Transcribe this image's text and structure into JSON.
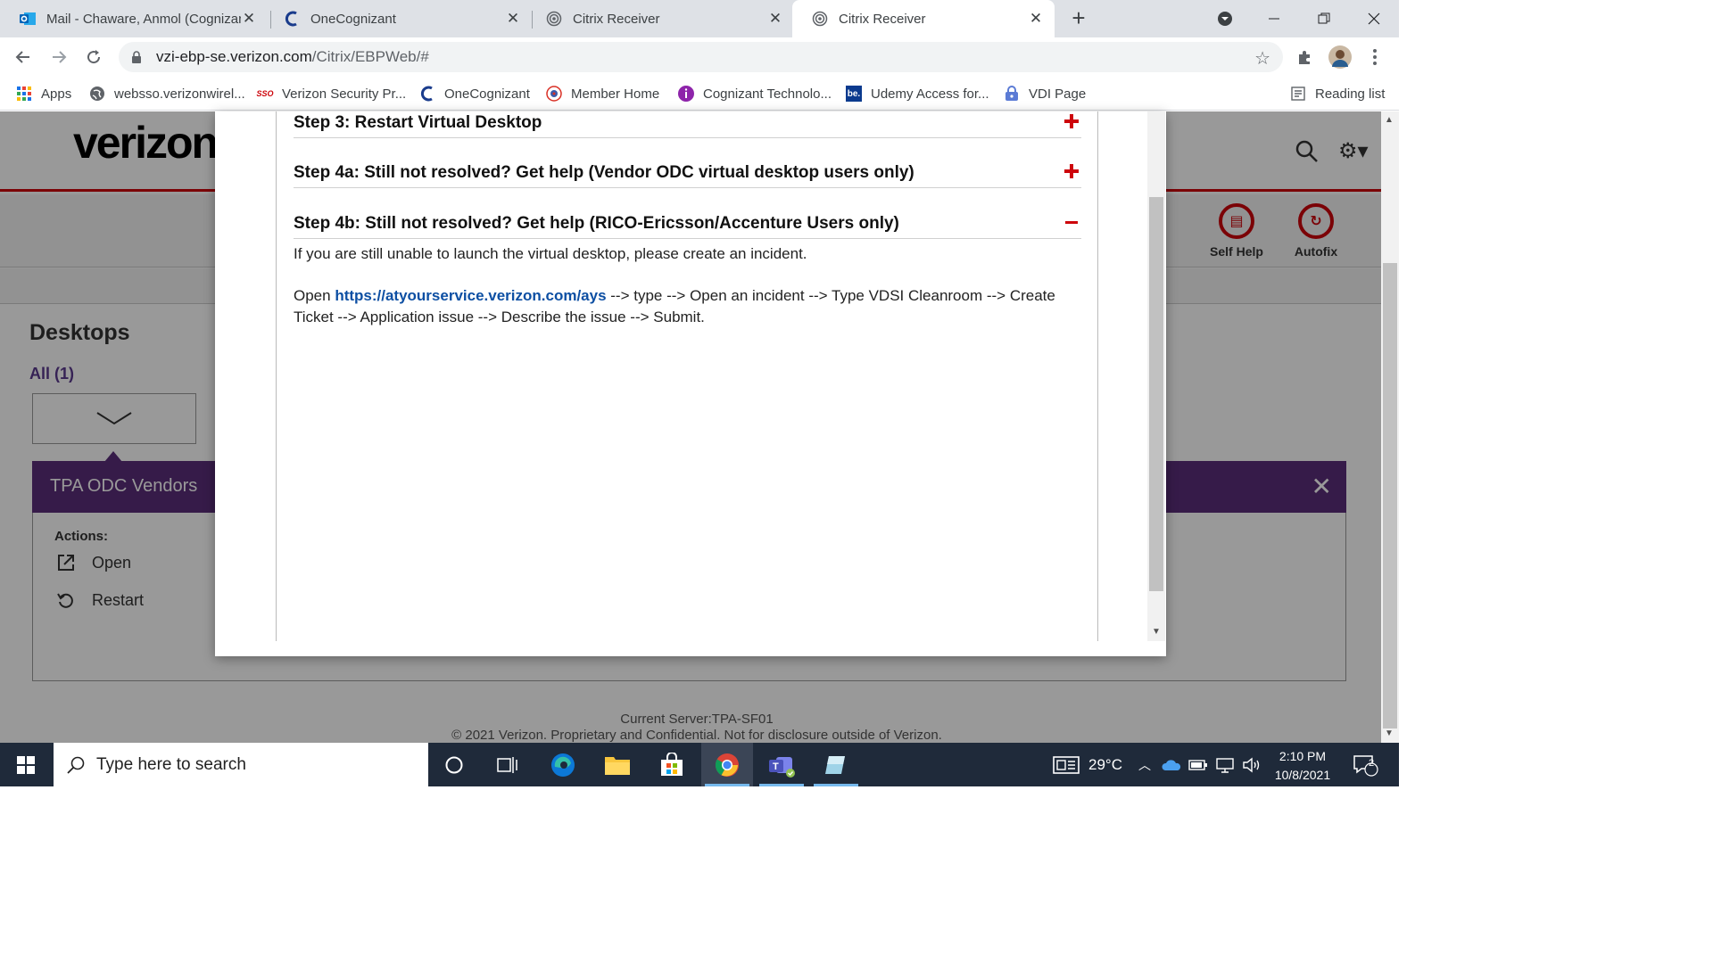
{
  "browser": {
    "tabs": [
      {
        "title": "Mail - Chaware, Anmol (Cognizant",
        "icon": "outlook-icon"
      },
      {
        "title": "OneCognizant",
        "icon": "onecognizant-icon"
      },
      {
        "title": "Citrix Receiver",
        "icon": "citrix-icon"
      },
      {
        "title": "Citrix Receiver",
        "icon": "citrix-icon",
        "active": true
      }
    ],
    "url_host": "vzi-ebp-se.verizon.com",
    "url_path": "/Citrix/EBPWeb/#",
    "bookmarks": [
      {
        "label": "Apps"
      },
      {
        "label": "websso.verizonwirel..."
      },
      {
        "label": "Verizon Security Pr..."
      },
      {
        "label": "OneCognizant"
      },
      {
        "label": "Member Home"
      },
      {
        "label": "Cognizant Technolo..."
      },
      {
        "label": "Udemy Access for..."
      },
      {
        "label": "VDI Page"
      }
    ],
    "reading_list": "Reading list",
    "sso_badge": "SSO",
    "be_badge": "be."
  },
  "page": {
    "logo": "verizon",
    "self_help": "Self Help",
    "autofix": "Autofix",
    "desktops_title": "Desktops",
    "filter_all": "All (1)",
    "vendor_name": "TPA ODC Vendors",
    "actions_label": "Actions:",
    "actions": [
      "Open",
      "Restart"
    ],
    "current_server": "Current Server:TPA-SF01",
    "copyright": "© 2021 Verizon. Proprietary and Confidential. Not for disclosure outside of Verizon.",
    "accent": "#cd040b",
    "purple": "#5a2d7a"
  },
  "modal": {
    "steps": [
      {
        "title": "Step 3: Restart Virtual Desktop",
        "state": "collapsed"
      },
      {
        "title": "Step 4a: Still not resolved? Get help (Vendor ODC virtual desktop users only)",
        "state": "collapsed"
      },
      {
        "title": "Step 4b: Still not resolved? Get help (RICO-Ericsson/Accenture Users only)",
        "state": "expanded"
      }
    ],
    "paragraph1": "If you are still unable to launch the virtual desktop, please create an incident.",
    "para2_prefix": "Open ",
    "para2_link": "https://atyourservice.verizon.com/ays",
    "para2_suffix": " --> type --> Open an incident --> Type VDSI Cleanroom --> Create Ticket --> Application issue --> Describe the issue --> Submit."
  },
  "taskbar": {
    "search_placeholder": "Type here to search",
    "temperature": "29°C",
    "time": "2:10 PM",
    "date": "10/8/2021",
    "notification_count": "2"
  }
}
